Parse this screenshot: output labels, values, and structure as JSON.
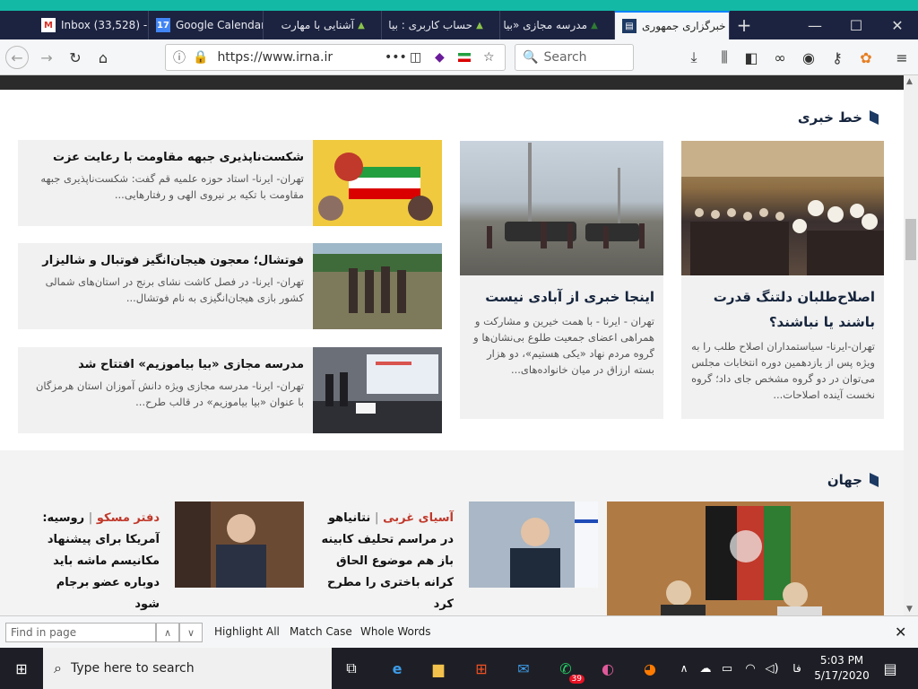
{
  "browser": {
    "tabs": [
      {
        "label": "Inbox (33,528) -",
        "icon": "gmail-icon"
      },
      {
        "label": "Google Calendar",
        "icon": "calendar-icon"
      },
      {
        "label": "آشنایی با مهارت",
        "icon": "site-icon"
      },
      {
        "label": "حساب کاربری : بیا",
        "icon": "site-icon"
      },
      {
        "label": "مدرسه مجازی «بیا",
        "icon": "site-icon"
      },
      {
        "label": "خبرگزاری جمهوری",
        "icon": "irna-icon",
        "active": true
      }
    ],
    "calendar_day": "17",
    "url": "https://www.irna.ir",
    "search_placeholder": "Search"
  },
  "page": {
    "section1_title": "خط خبری",
    "list_cards": [
      {
        "title": "شکست‌ناپذیری جبهه مقاومت با رعایت عزت",
        "desc": "تهران- ایرنا- استاد حوزه علمیه قم گفت: شکست‌ناپذیری جبهه مقاومت با تکیه بر نیروی الهی و رفتارهایی..."
      },
      {
        "title": "فوتشال؛ معجون هیجان‌انگیز فوتبال و شالیزار",
        "desc": "تهران- ایرنا- در فصل کاشت نشای برنج در استان‌های شمالی کشور بازی هیجان‌انگیزی به نام فوتشال..."
      },
      {
        "title": "مدرسه مجازی «بیا بیاموزیم» افتتاح شد",
        "desc": "تهران- ایرنا- مدرسه مجازی ویژه دانش آموزان استان هرمزگان با عنوان «بیا بیاموزیم» در قالب طرح..."
      }
    ],
    "mid_card": {
      "title": "اینجا خبری از آبادی نیست",
      "desc": "تهران - ایرنا - با همت خیرین و مشارکت و همراهی اعضای جمعیت طلوع بی‌نشان‌ها و گروه مردم نهاد «یکی هستیم»، دو هزار بسته ارزاق در میان خانواده‌های..."
    },
    "right_card": {
      "title": "اصلاح‌طلبان دلتنگ قدرت باشند یا نباشند؟",
      "desc": "تهران-ایرنا- سیاستمداران اصلاح طلب را به ویژه پس از یازدهمین دوره انتخابات مجلس می‌توان در دو گروه مشخص جای داد؛ گروه نخست آینده اصلاحات..."
    },
    "section2_title": "جهان",
    "world_cards": [
      {
        "category": "دفتر مسکو",
        "sep": "|",
        "title": "روسیه: آمریکا برای پیشنهاد مکانیسم ماشه باید دوباره عضو برجام شود"
      },
      {
        "category": "آسیای غربی",
        "sep": "|",
        "title": "نتانیاهو در مراسم تحلیف کابینه باز هم موضوع الحاق کرانه باختری را مطرح کرد"
      }
    ]
  },
  "findbar": {
    "placeholder": "Find in page",
    "highlight_all": "Highlight All",
    "match_case": "Match Case",
    "whole_words": "Whole Words"
  },
  "taskbar": {
    "search_placeholder": "Type here to search",
    "whatsapp_badge": "39",
    "lang": "فا",
    "time": "5:03 PM",
    "date": "5/17/2020"
  }
}
